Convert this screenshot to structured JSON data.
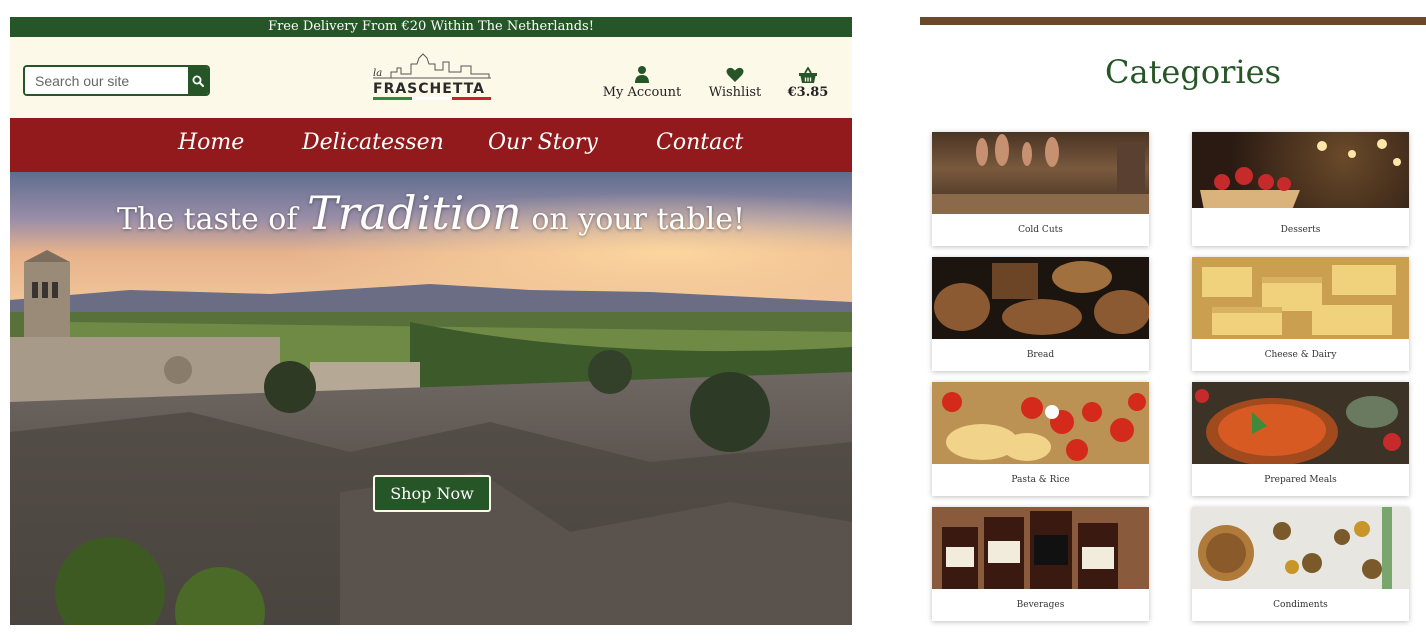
{
  "topbar": {
    "text": "Free Delivery From €20 Within The Netherlands!"
  },
  "header": {
    "search_placeholder": "Search our site",
    "logo": {
      "small": "la",
      "word": "FRASCHETTA"
    },
    "account_label": "My Account",
    "wishlist_label": "Wishlist",
    "basket_total": "€3.85"
  },
  "nav": {
    "items": [
      "Home",
      "Delicatessen",
      "Our Story",
      "Contact"
    ]
  },
  "hero": {
    "title_before": "The taste of",
    "title_script": "Tradition",
    "title_after": "on your table!",
    "button_label": "Shop Now"
  },
  "categories": {
    "title": "Categories",
    "items": [
      {
        "label": "Cold Cuts"
      },
      {
        "label": "Desserts"
      },
      {
        "label": "Bread"
      },
      {
        "label": "Cheese & Dairy"
      },
      {
        "label": "Pasta & Rice"
      },
      {
        "label": "Prepared Meals"
      },
      {
        "label": "Beverages"
      },
      {
        "label": "Condiments"
      }
    ]
  },
  "colors": {
    "green": "#265627",
    "red": "#921a1c",
    "cream": "#fdf9e9"
  },
  "icons": [
    "search-icon",
    "user-icon",
    "heart-icon",
    "basket-icon"
  ]
}
